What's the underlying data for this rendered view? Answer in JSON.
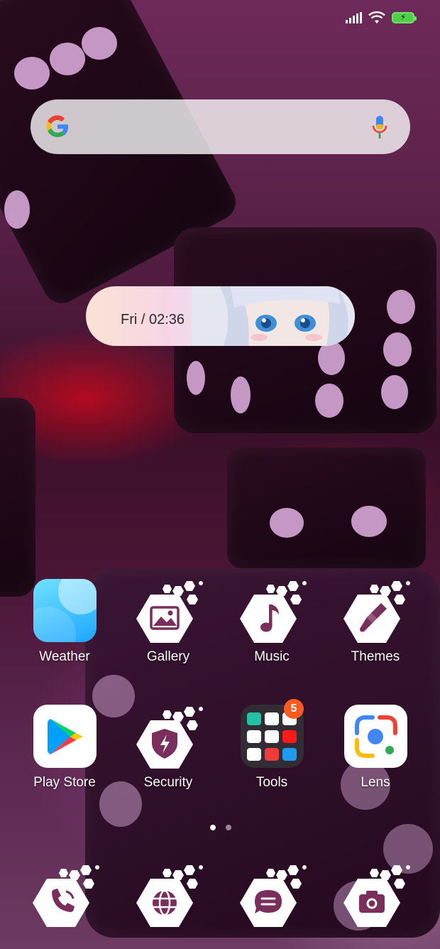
{
  "status_bar": {
    "signal_icon": "cell-signal-icon",
    "wifi_icon": "wifi-icon",
    "battery_icon": "battery-charging-icon"
  },
  "search_bar": {
    "logo_icon": "google-g-icon",
    "voice_icon": "microphone-icon"
  },
  "clock_widget": {
    "text": "Fri / 02:36"
  },
  "apps": {
    "weather": "Weather",
    "gallery": "Gallery",
    "music": "Music",
    "themes": "Themes",
    "play_store": "Play Store",
    "security": "Security",
    "tools": "Tools",
    "tools_badge": "5",
    "lens": "Lens"
  },
  "dock": {
    "phone_icon": "phone-icon",
    "browser_icon": "globe-icon",
    "messages_icon": "message-icon",
    "camera_icon": "camera-icon"
  },
  "page_indicator": {
    "pages": 2,
    "current": 1
  },
  "colors": {
    "icon_hex": "#ffffff",
    "glyph": "#7a2e5c",
    "badge": "#ff5a1f",
    "battery": "#4fcf4a"
  }
}
